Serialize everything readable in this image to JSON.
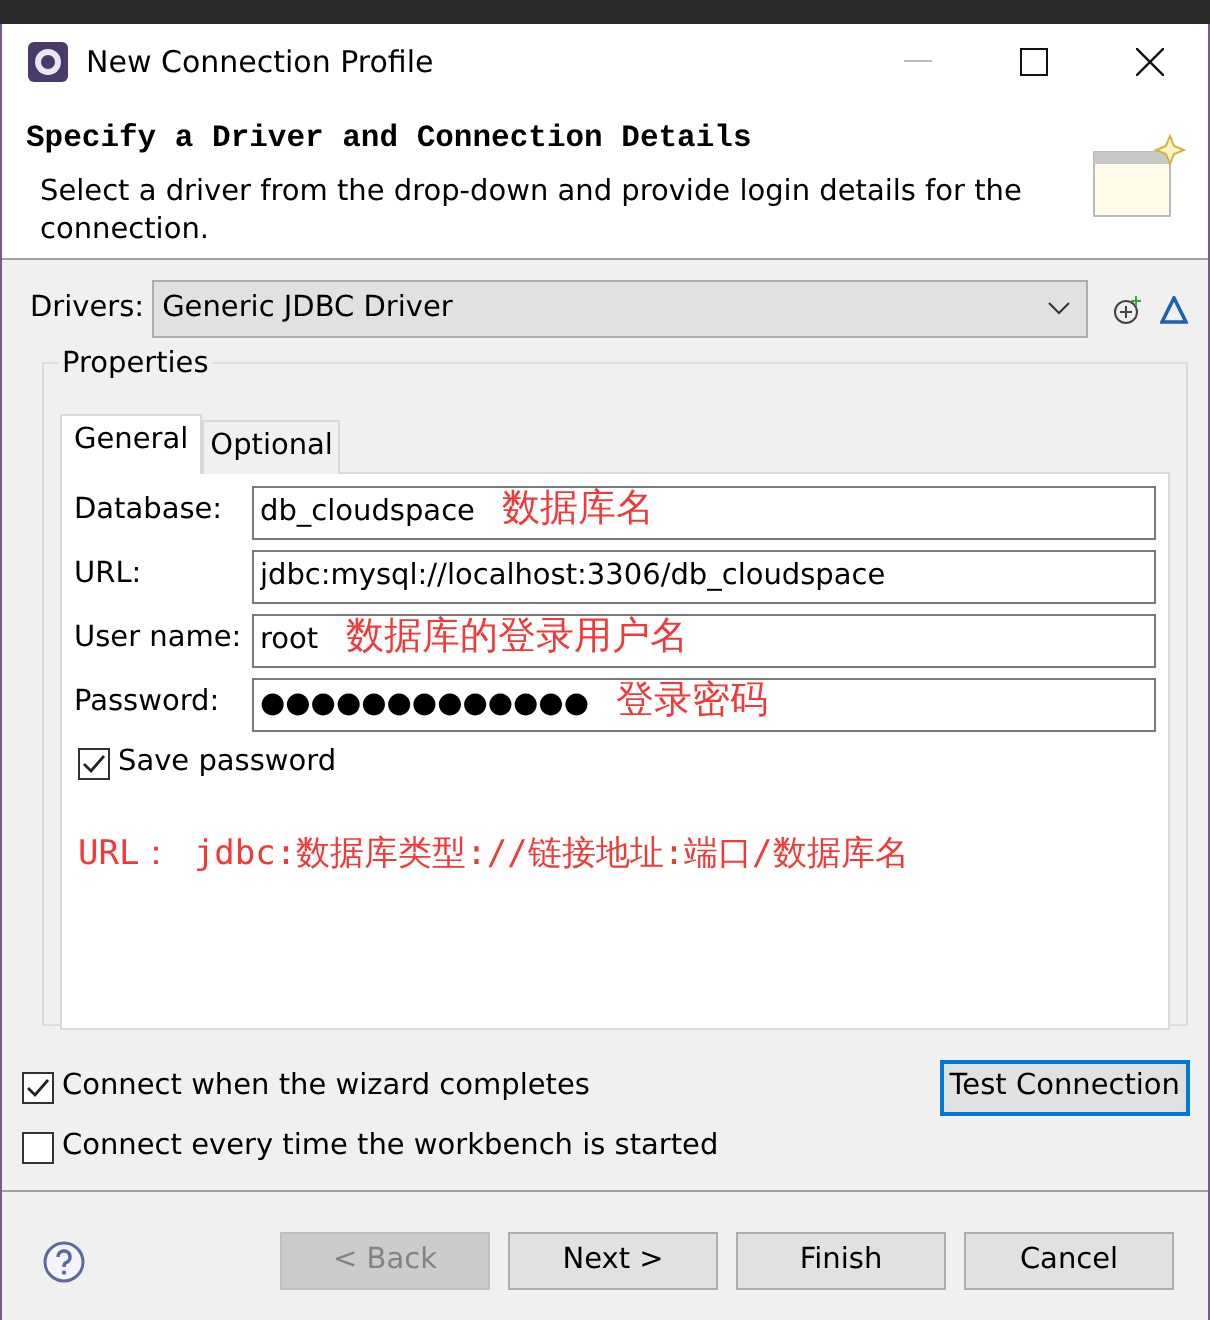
{
  "window": {
    "title": "New Connection Profile"
  },
  "header": {
    "title": "Specify a Driver and Connection Details",
    "description": "Select a driver from the drop-down and provide login details for the connection."
  },
  "drivers": {
    "label": "Drivers:",
    "value": "Generic JDBC Driver"
  },
  "properties": {
    "title": "Properties",
    "tabs": [
      {
        "label": "General",
        "selected": true
      },
      {
        "label": "Optional",
        "selected": false
      }
    ],
    "fields": [
      {
        "label": "Database:",
        "value": "db_cloudspace",
        "annotation": "数据库名"
      },
      {
        "label": "URL:",
        "value": "jdbc:mysql://localhost:3306/db_cloudspace"
      },
      {
        "label": "User name:",
        "value": "root",
        "annotation": "数据库的登录用户名"
      },
      {
        "label": "Password:",
        "value": "●●●●●●●●●●●●●",
        "annotation": "登录密码"
      }
    ],
    "save_password": {
      "label": "Save password",
      "checked": true
    },
    "note": "URL： jdbc:数据库类型://链接地址:端口/数据库名"
  },
  "options": [
    {
      "label": "Connect when the wizard completes",
      "checked": true
    },
    {
      "label": "Connect every time the workbench is started",
      "checked": false
    }
  ],
  "test_button": {
    "label": "Test Connection",
    "focused": true
  },
  "buttons": [
    {
      "label": "< Back",
      "disabled": true
    },
    {
      "label": "Next >",
      "disabled": false
    },
    {
      "label": "Finish",
      "disabled": false
    },
    {
      "label": "Cancel",
      "disabled": false
    }
  ]
}
